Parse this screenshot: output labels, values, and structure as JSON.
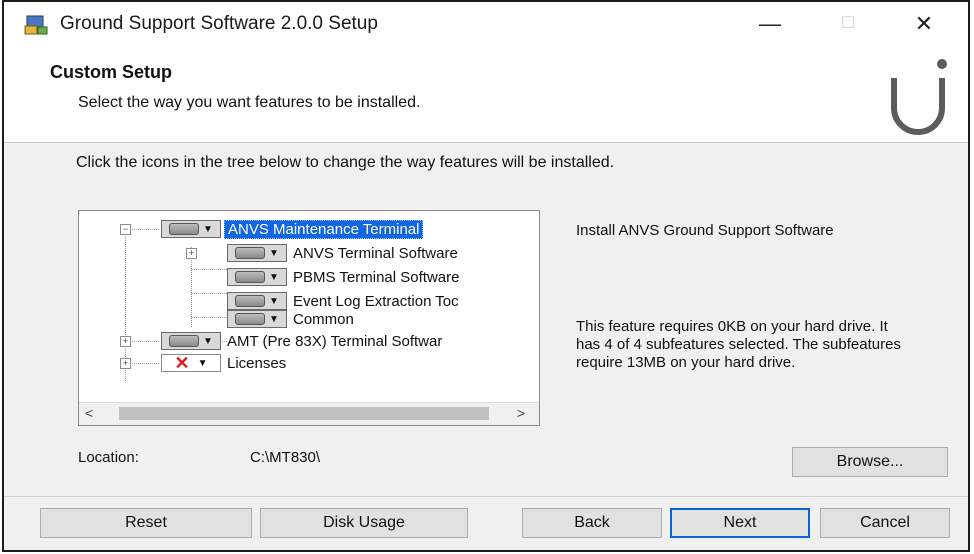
{
  "window": {
    "title": "Ground Support Software 2.0.0 Setup",
    "controls": {
      "minimize": "—",
      "maximize": "☐",
      "close": "✕"
    }
  },
  "header": {
    "title": "Custom Setup",
    "subtitle": "Select the way you want features to be installed."
  },
  "instruction": "Click the icons in the tree below to change the way features will be installed.",
  "tree": {
    "items": [
      {
        "label": "ANVS Maintenance Terminal",
        "state": "install",
        "selected": true
      },
      {
        "label": "ANVS Terminal Software",
        "state": "install"
      },
      {
        "label": "PBMS Terminal Software",
        "state": "install"
      },
      {
        "label": "Event Log Extraction Toc",
        "state": "install"
      },
      {
        "label": "Common",
        "state": "install"
      },
      {
        "label": "AMT (Pre 83X) Terminal Softwar",
        "state": "install"
      },
      {
        "label": "Licenses",
        "state": "unavailable"
      }
    ],
    "scroll_left": "<",
    "scroll_right": ">"
  },
  "description": {
    "text": "Install ANVS Ground Support Software",
    "requirements": "This feature requires 0KB on your hard drive. It has 4 of 4 subfeatures selected. The subfeatures require 13MB on your hard drive."
  },
  "location": {
    "label": "Location:",
    "value": "C:\\MT830\\"
  },
  "buttons": {
    "browse": "Browse...",
    "reset": "Reset",
    "disk_usage": "Disk Usage",
    "back": "Back",
    "next": "Next",
    "cancel": "Cancel"
  },
  "colors": {
    "selection": "#1266e0",
    "primary_border": "#0a64d8",
    "unavailable_x": "#d81e1e"
  }
}
